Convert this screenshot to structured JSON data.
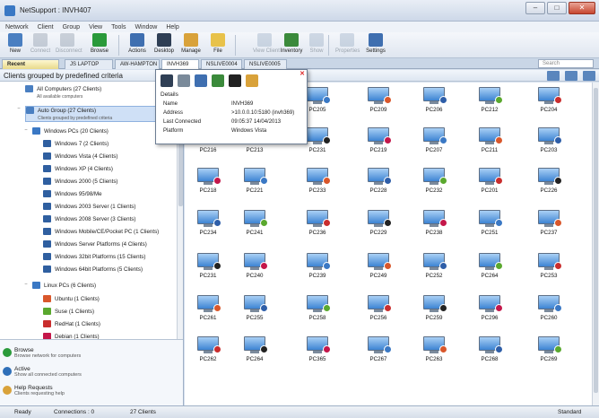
{
  "window": {
    "title": "NetSupport : INVH407"
  },
  "menu": [
    "Network",
    "Client",
    "Group",
    "View",
    "Tools",
    "Window",
    "Help"
  ],
  "toolbar": [
    {
      "label": "New",
      "icon": "new-icon",
      "color": "#4a7fc1",
      "disabled": false
    },
    {
      "label": "Connect",
      "icon": "connect-icon",
      "color": "#7a8a9a",
      "disabled": true
    },
    {
      "label": "Disconnect",
      "icon": "disconnect-icon",
      "color": "#7a8a9a",
      "disabled": true
    },
    {
      "label": "Browse",
      "icon": "browse-icon",
      "color": "#2a9a3a",
      "disabled": false
    },
    {
      "label": "Actions",
      "icon": "actions-icon",
      "color": "#3f6fb0",
      "disabled": false
    },
    {
      "label": "Desktop",
      "icon": "desktop-icon",
      "color": "#2f3f55",
      "disabled": false
    },
    {
      "label": "Manage",
      "icon": "manage-icon",
      "color": "#d9a23a",
      "disabled": false
    },
    {
      "label": "File",
      "icon": "file-icon",
      "color": "#e8c24a",
      "disabled": false
    },
    {
      "label": "View Client",
      "icon": "view-client-icon",
      "color": "#8aa0bb",
      "disabled": true
    },
    {
      "label": "Inventory",
      "icon": "inventory-icon",
      "color": "#3b8a3b",
      "disabled": false
    },
    {
      "label": "Show",
      "icon": "show-icon",
      "color": "#8aa0bb",
      "disabled": true
    },
    {
      "label": "Properties",
      "icon": "properties-icon",
      "color": "#8aa0bb",
      "disabled": true
    },
    {
      "label": "Settings",
      "icon": "settings-icon",
      "color": "#3f6fb0",
      "disabled": false
    }
  ],
  "tabs": [
    "Recent",
    "JS LAPTOP",
    "AW-HAMPTON",
    "INVH369",
    "NSLIVE0004",
    "NSLIVE0005"
  ],
  "search": {
    "placeholder": "Search"
  },
  "left": {
    "header": "Clients grouped by predefined criteria",
    "tree": [
      {
        "label": "All Computers (27 Clients)",
        "sub": "All available computers",
        "icon": "all-computers-icon",
        "color": "#4a7fc1"
      },
      {
        "label": "Auto Group (27 Clients)",
        "sub": "Clients grouped by predefined criteria",
        "icon": "auto-group-icon",
        "color": "#4a7fc1"
      },
      {
        "label": "Windows PCs (20 Clients)",
        "sub": "",
        "icon": "windows-pcs-icon",
        "color": "#3a78c4"
      },
      {
        "label": "Windows 7 (2 Clients)",
        "sub": "",
        "icon": "windows-7-icon",
        "color": "#2f5fa0"
      },
      {
        "label": "Windows Vista (4 Clients)",
        "sub": "",
        "icon": "windows-vista-icon",
        "color": "#2f5fa0"
      },
      {
        "label": "Windows XP (4 Clients)",
        "sub": "",
        "icon": "windows-xp-icon",
        "color": "#2f5fa0"
      },
      {
        "label": "Windows 2000 (5 Clients)",
        "sub": "",
        "icon": "windows-2000-icon",
        "color": "#2f5fa0"
      },
      {
        "label": "Windows 95/98/Me",
        "sub": "",
        "icon": "windows-95-icon",
        "color": "#2f5fa0"
      },
      {
        "label": "Windows 2003 Server (1 Clients)",
        "sub": "",
        "icon": "windows-2003-icon",
        "color": "#2f5fa0"
      },
      {
        "label": "Windows 2008 Server (3 Clients)",
        "sub": "",
        "icon": "windows-2008-icon",
        "color": "#2f5fa0"
      },
      {
        "label": "Windows Mobile/CE/Pocket PC (1 Clients)",
        "sub": "",
        "icon": "windows-mobile-icon",
        "color": "#2f5fa0"
      },
      {
        "label": "Windows Server Platforms (4 Clients)",
        "sub": "",
        "icon": "windows-server-icon",
        "color": "#2f5fa0"
      },
      {
        "label": "Windows 32bit Platforms (15 Clients)",
        "sub": "",
        "icon": "windows-32bit-icon",
        "color": "#2f5fa0"
      },
      {
        "label": "Windows 64bit Platforms (5 Clients)",
        "sub": "",
        "icon": "windows-64bit-icon",
        "color": "#2f5fa0"
      },
      {
        "label": "Linux PCs (6 Clients)",
        "sub": "",
        "icon": "linux-pcs-icon",
        "color": "#3a78c4"
      },
      {
        "label": "Ubuntu (1 Clients)",
        "sub": "",
        "icon": "ubuntu-icon",
        "color": "#d9572b"
      },
      {
        "label": "Suse (1 Clients)",
        "sub": "",
        "icon": "suse-icon",
        "color": "#5aa82e"
      },
      {
        "label": "RedHat (1 Clients)",
        "sub": "",
        "icon": "redhat-icon",
        "color": "#c92d2d"
      },
      {
        "label": "Debian (1 Clients)",
        "sub": "",
        "icon": "debian-icon",
        "color": "#c4174a"
      },
      {
        "label": "Fedora (1 Clients)",
        "sub": "",
        "icon": "fedora-icon",
        "color": "#2e5ea8"
      },
      {
        "label": "Apple Mac OS X (1 Clients)",
        "sub": "",
        "icon": "apple-icon",
        "color": "#8a8a8a"
      },
      {
        "label": "Client Versions (27 Clients)",
        "sub": "",
        "icon": "client-versions-icon",
        "color": "#3aa05a"
      }
    ],
    "tasks": [
      {
        "title": "Browse",
        "desc": "Browse network for computers",
        "icon": "browse-task-icon",
        "color": "#2a9a3a"
      },
      {
        "title": "Active",
        "desc": "Show all connected computers",
        "icon": "active-task-icon",
        "color": "#2f6fb8"
      },
      {
        "title": "Help Requests",
        "desc": "Clients requesting help",
        "icon": "help-requests-icon",
        "color": "#d9a23a"
      }
    ]
  },
  "clients": [
    [
      "PC205",
      "PC209",
      "PC206",
      "PC212",
      "PC204"
    ],
    [
      "PC216",
      "PC213",
      "PC231",
      "PC219",
      "PC207",
      "PC211",
      "PC203"
    ],
    [
      "PC218",
      "PC221",
      "PC233",
      "PC228",
      "PC232",
      "PC201",
      "PC226"
    ],
    [
      "PC234",
      "PC241",
      "PC236",
      "PC229",
      "PC238",
      "PC251",
      "PC237"
    ],
    [
      "PC231",
      "PC240",
      "PC239",
      "PC249",
      "PC252",
      "PC264",
      "PC253"
    ],
    [
      "PC261",
      "PC255",
      "PC258",
      "PC256",
      "PC259",
      "PC296",
      "PC260"
    ],
    [
      "PC262",
      "PC264",
      "PC365",
      "PC267",
      "PC263",
      "PC268",
      "PC269"
    ]
  ],
  "popup": {
    "section": "Details",
    "rows": [
      {
        "k": "Name",
        "v": "INVH369"
      },
      {
        "k": "Address",
        "v": ">10.0.0.10:5180 (invh369)"
      },
      {
        "k": "Last Connected",
        "v": "09:05:37 14/04/2013"
      },
      {
        "k": "Platform",
        "v": "Windows Vista"
      }
    ],
    "icon_colors": [
      "#2f3f55",
      "#7a8a9a",
      "#3f6fb0",
      "#3b8a3b",
      "#222222",
      "#d9a23a"
    ]
  },
  "status": {
    "ready": "Ready",
    "connections": "Connections : 0",
    "clients": "27 Clients",
    "mode": "Standard"
  },
  "colors": {
    "accent": "#3a78c4",
    "selection": "#cfe0f6"
  }
}
